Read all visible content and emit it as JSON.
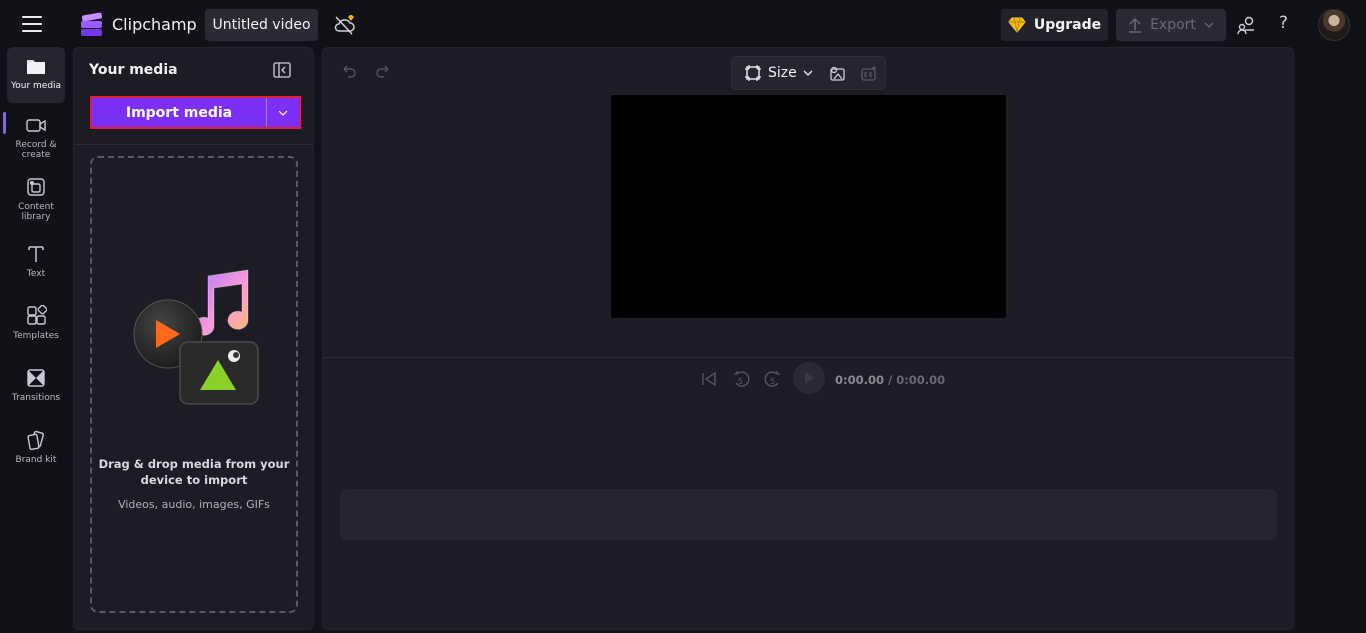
{
  "topbar": {
    "brand": "Clipchamp",
    "project_title": "Untitled video",
    "upgrade_label": "Upgrade",
    "export_label": "Export",
    "help_label": "?"
  },
  "rail": {
    "items": [
      {
        "label": "Your media",
        "icon": "folder-icon",
        "active": true
      },
      {
        "label": "Record & create",
        "icon": "camera-icon"
      },
      {
        "label": "Content library",
        "icon": "library-icon"
      },
      {
        "label": "Text",
        "icon": "text-icon"
      },
      {
        "label": "Templates",
        "icon": "templates-icon"
      },
      {
        "label": "Transitions",
        "icon": "transitions-icon"
      },
      {
        "label": "Brand kit",
        "icon": "brand-kit-icon"
      }
    ]
  },
  "media_panel": {
    "title": "Your media",
    "import_label": "Import media",
    "drop_main": "Drag & drop media from your device to import",
    "drop_sub": "Videos, audio, images, GIFs"
  },
  "editor": {
    "size_label": "Size",
    "current_time": "0:00.00",
    "total_time": "/ 0:00.00",
    "skip_back_seconds": "5",
    "skip_forward_seconds": "5"
  },
  "colors": {
    "accent": "#7c2ff5",
    "highlight_border": "#e01f3d",
    "background": "#111118",
    "panel": "#1c1c24"
  }
}
